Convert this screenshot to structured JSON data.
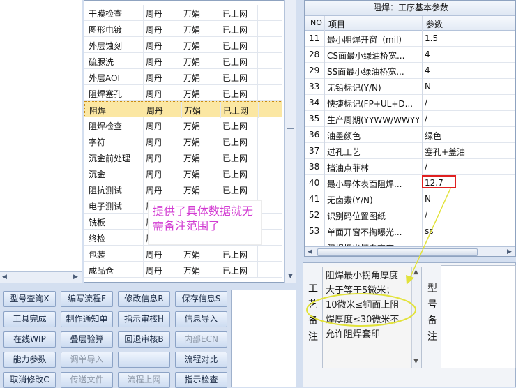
{
  "process_list": {
    "rows": [
      {
        "name": "干膜检查",
        "person": "周丹",
        "reviewer": "万娟",
        "status": "已上网"
      },
      {
        "name": "图形电镀",
        "person": "周丹",
        "reviewer": "万娟",
        "status": "已上网"
      },
      {
        "name": "外层蚀刻",
        "person": "周丹",
        "reviewer": "万娟",
        "status": "已上网"
      },
      {
        "name": "硫脲洗",
        "person": "周丹",
        "reviewer": "万娟",
        "status": "已上网"
      },
      {
        "name": "外层AOI",
        "person": "周丹",
        "reviewer": "万娟",
        "status": "已上网"
      },
      {
        "name": "阻焊塞孔",
        "person": "周丹",
        "reviewer": "万娟",
        "status": "已上网"
      },
      {
        "name": "阻焊",
        "person": "周丹",
        "reviewer": "万娟",
        "status": "已上网"
      },
      {
        "name": "阻焊检查",
        "person": "周丹",
        "reviewer": "万娟",
        "status": "已上网"
      },
      {
        "name": "字符",
        "person": "周丹",
        "reviewer": "万娟",
        "status": "已上网"
      },
      {
        "name": "沉金前处理",
        "person": "周丹",
        "reviewer": "万娟",
        "status": "已上网"
      },
      {
        "name": "沉金",
        "person": "周丹",
        "reviewer": "万娟",
        "status": "已上网"
      },
      {
        "name": "阻抗测试",
        "person": "周丹",
        "reviewer": "万娟",
        "status": "已上网"
      },
      {
        "name": "电子测试",
        "person": "周",
        "reviewer": "",
        "status": ""
      },
      {
        "name": "铣板",
        "person": "周",
        "reviewer": "",
        "status": ""
      },
      {
        "name": "终检",
        "person": "周",
        "reviewer": "",
        "status": ""
      },
      {
        "name": "包装",
        "person": "周丹",
        "reviewer": "万娟",
        "status": "已上网"
      },
      {
        "name": "成品仓",
        "person": "周丹",
        "reviewer": "万娟",
        "status": "已上网"
      }
    ],
    "selected_index": 6
  },
  "annotation": "提供了具体数据就无需备注范围了",
  "buttons": {
    "row1": [
      "型号查询X",
      "编写流程F",
      "修改信息R",
      "保存信息S"
    ],
    "row2": [
      "工具完成",
      "制作通知单",
      "指示审核H",
      "信息导入"
    ],
    "row3": [
      "在线WIP",
      "叠层验算",
      "回退审核B",
      "内部ECN"
    ],
    "row4": [
      "能力参数",
      "调单导入",
      "",
      "流程对比"
    ],
    "row5": [
      "取消修改C",
      "传送文件",
      "流程上网",
      "指示检查"
    ]
  },
  "params": {
    "title": "阻焊：工序基本参数",
    "headers": {
      "no": "NO",
      "item": "项目",
      "value": "参数"
    },
    "rows": [
      {
        "no": "11",
        "item": "最小阻焊开窗（mil）",
        "value": "1.5"
      },
      {
        "no": "28",
        "item": "CS面最小绿油桥宽...",
        "value": "4"
      },
      {
        "no": "29",
        "item": "SS面最小绿油桥宽...",
        "value": "4"
      },
      {
        "no": "33",
        "item": "无铅标记(Y/N)",
        "value": "N"
      },
      {
        "no": "34",
        "item": "快捷标记(FP+UL+D...",
        "value": "/"
      },
      {
        "no": "35",
        "item": "生产周期(YYWW/WWYY)",
        "value": "/"
      },
      {
        "no": "36",
        "item": "油墨颜色",
        "value": "绿色"
      },
      {
        "no": "37",
        "item": "过孔工艺",
        "value": "塞孔+盖油"
      },
      {
        "no": "38",
        "item": "挡油点菲林",
        "value": "/"
      },
      {
        "no": "40",
        "item": "最小导体表面阻焊...",
        "value": "12.7"
      },
      {
        "no": "41",
        "item": "无卤素(Y/N)",
        "value": "N"
      },
      {
        "no": "52",
        "item": "识别码位置图纸",
        "value": "/"
      },
      {
        "no": "53",
        "item": "单面开窗不掏曝光...",
        "value": "ss"
      },
      {
        "no": "",
        "item": "阻焊把出模自高度",
        "value": ""
      }
    ]
  },
  "notes": {
    "label_chars": [
      "工",
      "艺",
      "备",
      "注"
    ],
    "text_lines": [
      "阻焊最小拐角厚度",
      "大于等于5微米；",
      "10微米≤铜面上阻",
      "焊厚度≤30微米不",
      "允许阻焊套印"
    ],
    "model_label_chars": [
      "型",
      "号",
      "备",
      "注"
    ]
  },
  "colors": {
    "annotation": "#d23bd2",
    "highlight_box": "#e02020",
    "callout_ellipse": "#e2e23a",
    "selected_row": "#fbe7a3"
  }
}
